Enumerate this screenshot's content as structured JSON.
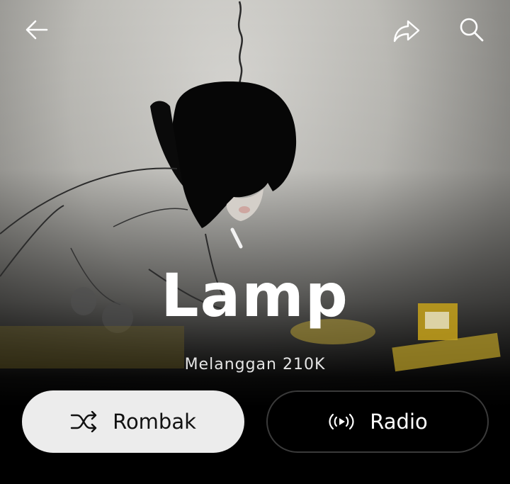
{
  "header": {
    "back_icon": "arrow-left-icon",
    "share_icon": "share-icon",
    "search_icon": "search-icon"
  },
  "artist": {
    "name": "Lamp",
    "subscribers": "Melanggan 210K"
  },
  "actions": {
    "shuffle_label": "Rombak",
    "shuffle_icon": "shuffle-icon",
    "radio_label": "Radio",
    "radio_icon": "radio-broadcast-icon"
  },
  "colors": {
    "shuffle_bg": "#ececec",
    "radio_border": "#3a3a3a",
    "background": "#000000"
  }
}
